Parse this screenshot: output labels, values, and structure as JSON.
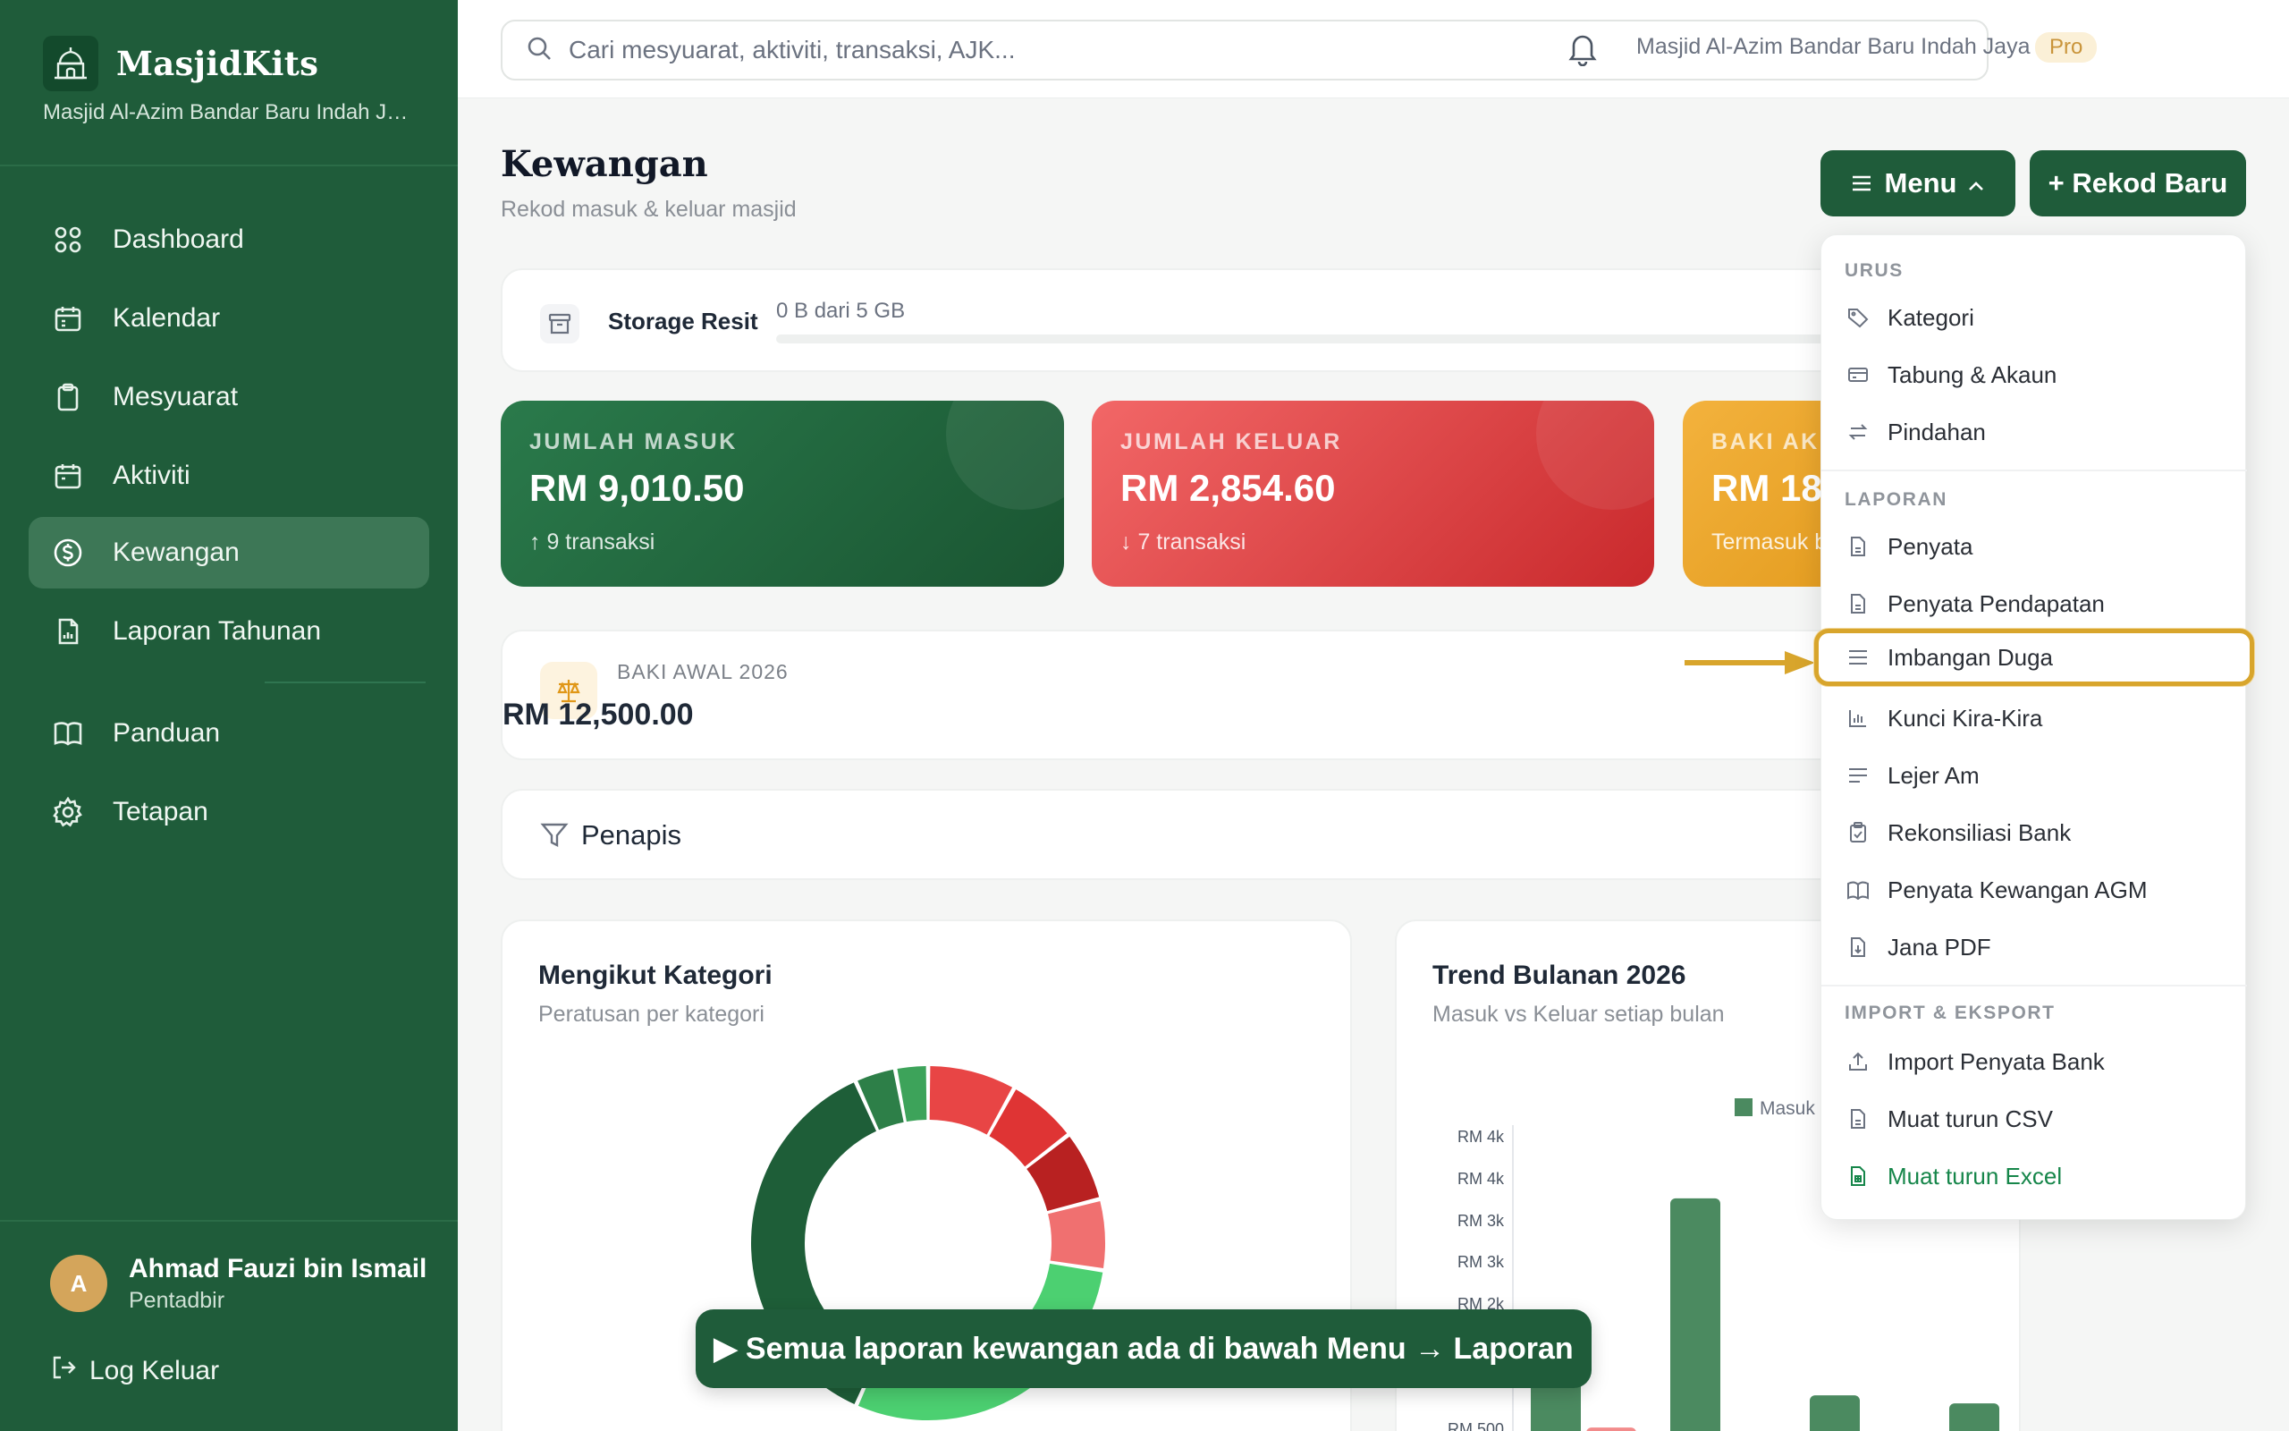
{
  "brand": {
    "name": "MasjidKits",
    "subtitle": "Masjid Al-Azim Bandar Baru Indah Jaya"
  },
  "sidebar": {
    "items": [
      {
        "label": "Dashboard",
        "icon": "grid-icon"
      },
      {
        "label": "Kalendar",
        "icon": "calendar-icon"
      },
      {
        "label": "Mesyuarat",
        "icon": "clipboard-icon"
      },
      {
        "label": "Aktiviti",
        "icon": "calendar-icon"
      },
      {
        "label": "Kewangan",
        "icon": "dollar-circle-icon",
        "active": true
      },
      {
        "label": "Laporan Tahunan",
        "icon": "report-icon"
      },
      {
        "label": "Panduan",
        "icon": "book-icon"
      },
      {
        "label": "Tetapan",
        "icon": "gear-icon"
      }
    ],
    "user": {
      "initial": "A",
      "name": "Ahmad Fauzi bin Ismail",
      "role": "Pentadbir"
    },
    "logout_label": "Log Keluar"
  },
  "topbar": {
    "search_placeholder": "Cari mesyuarat, aktiviti, transaksi, AJK...",
    "org_name": "Masjid Al-Azim Bandar Baru Indah Jaya",
    "plan_badge": "Pro"
  },
  "page": {
    "title": "Kewangan",
    "subtitle": "Rekod masuk & keluar masjid",
    "menu_button": "Menu",
    "new_button": "+ Rekod Baru"
  },
  "storage": {
    "label": "Storage Resit",
    "value": "0 B dari 5 GB",
    "used_fraction": 0
  },
  "stats": {
    "income": {
      "title": "JUMLAH MASUK",
      "value": "RM 9,010.50",
      "sub": "9 transaksi"
    },
    "expense": {
      "title": "JUMLAH KELUAR",
      "value": "RM 2,854.60",
      "sub": "7 transaksi"
    },
    "balance": {
      "title": "BAKI AKH",
      "value": "RM 18",
      "sub": "Termasuk b"
    }
  },
  "opening_balance": {
    "label": "BAKI AWAL 2026",
    "value": "RM 12,500.00"
  },
  "filter": {
    "label": "Penapis"
  },
  "category_chart": {
    "title": "Mengikut Kategori",
    "subtitle": "Peratusan per kategori"
  },
  "trend_chart": {
    "title": "Trend Bulanan 2026",
    "subtitle": "Masuk vs Keluar setiap bulan"
  },
  "dropdown": {
    "sections": [
      {
        "heading": "URUS",
        "items": [
          {
            "label": "Kategori",
            "icon": "tag-icon"
          },
          {
            "label": "Tabung & Akaun",
            "icon": "wallet-icon"
          },
          {
            "label": "Pindahan",
            "icon": "transfer-icon"
          }
        ]
      },
      {
        "heading": "LAPORAN",
        "items": [
          {
            "label": "Penyata",
            "icon": "document-icon"
          },
          {
            "label": "Penyata Pendapatan",
            "icon": "document-icon"
          },
          {
            "label": "Imbangan Duga",
            "icon": "lines-icon",
            "highlight": true
          },
          {
            "label": "Kunci Kira-Kira",
            "icon": "bar-chart-icon"
          },
          {
            "label": "Lejer Am",
            "icon": "lines-icon"
          },
          {
            "label": "Rekonsiliasi Bank",
            "icon": "clipboard-check-icon"
          },
          {
            "label": "Penyata Kewangan AGM",
            "icon": "book-icon"
          },
          {
            "label": "Jana PDF",
            "icon": "download-doc-icon"
          }
        ]
      },
      {
        "heading": "IMPORT & EKSPORT",
        "items": [
          {
            "label": "Import Penyata Bank",
            "icon": "upload-icon"
          },
          {
            "label": "Muat turun CSV",
            "icon": "document-icon"
          },
          {
            "label": "Muat turun Excel",
            "icon": "spreadsheet-icon",
            "green": true
          }
        ]
      }
    ]
  },
  "donut_chart": {
    "type": "pie",
    "slices": [
      {
        "value": 6.5,
        "color": "#e84545"
      },
      {
        "value": 5.2,
        "color": "#df3434"
      },
      {
        "value": 5.2,
        "color": "#b82121"
      },
      {
        "value": 5.2,
        "color": "#f07070"
      },
      {
        "value": 23.5,
        "color": "#4cd071"
      },
      {
        "value": 29.5,
        "color": "#1e5e38"
      },
      {
        "value": 3.0,
        "color": "#2d7f48"
      },
      {
        "value": 2.4,
        "color": "#3da35a"
      }
    ]
  },
  "chart_data": {
    "type": "bar",
    "title": "Trend Bulanan 2026",
    "subtitle": "Masuk vs Keluar setiap bulan",
    "legend": [
      "Masuk"
    ],
    "y_ticks": [
      "RM 4k",
      "RM 4k",
      "RM 3k",
      "RM 3k",
      "RM 2k",
      "RM 500"
    ],
    "ylim": [
      0,
      4250
    ],
    "series": [
      {
        "name": "Masuk",
        "color": "#4b8a60",
        "values": [
          1750,
          3450,
          1000,
          900,
          800
        ]
      },
      {
        "color": "#f28b8b",
        "values": [
          600,
          420,
          370,
          150,
          280
        ]
      }
    ]
  },
  "toast": {
    "text": "▶ Semua laporan kewangan ada di bawah Menu → Laporan"
  },
  "colors": {
    "primary": "#1f5c3a",
    "highlight": "#d8a52c"
  }
}
